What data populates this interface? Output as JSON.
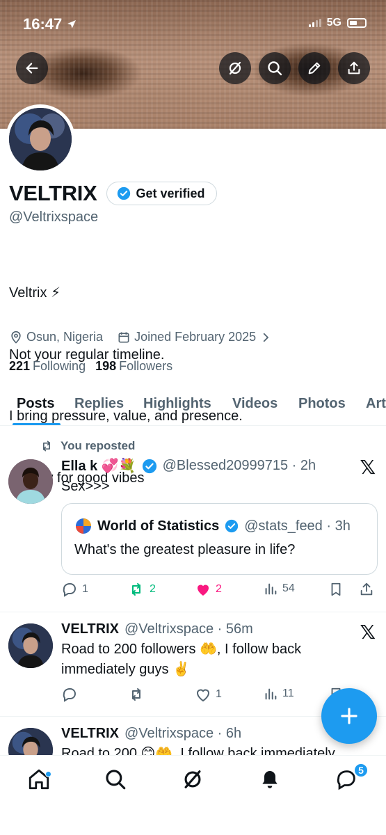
{
  "status_bar": {
    "time": "16:47",
    "network": "5G"
  },
  "profile": {
    "display_name": "VELTRIX",
    "verify_label": "Get verified",
    "handle": "@Veltrixspace",
    "bio_lines": [
      "Veltrix ⚡",
      "Not your regular timeline.",
      "I bring pressure, value, and presence.",
      " Follow for good vibes"
    ],
    "location": "Osun, Nigeria",
    "joined": "Joined February 2025",
    "following_count": "221",
    "following_label": "Following",
    "followers_count": "198",
    "followers_label": "Followers"
  },
  "tabs": [
    "Posts",
    "Replies",
    "Highlights",
    "Videos",
    "Photos",
    "Art"
  ],
  "posts": [
    {
      "repost_label": "You reposted",
      "name": "Ella k 💞💐",
      "handle_time": "@Blessed20999715 · 2h",
      "text": "Sex>>>",
      "quote": {
        "name": "World of Statistics",
        "handle_time": "@stats_feed · 3h",
        "text": "What's the greatest pleasure in life?"
      },
      "replies": "1",
      "reposts": "2",
      "likes": "2",
      "views": "54"
    },
    {
      "name": "VELTRIX",
      "handle_time": "@Veltrixspace · 56m",
      "text": "Road to 200 followers 🤲, I follow back immediately guys ✌️",
      "replies": "",
      "reposts": "",
      "likes": "1",
      "views": "11"
    },
    {
      "name": "VELTRIX",
      "handle_time": "@Veltrixspace · 6h",
      "text": "Road to 200 😊🤲, I follow back immediately"
    }
  ],
  "nav": {
    "messages_badge": "5"
  },
  "colors": {
    "accent": "#1d9bf0",
    "repost_green": "#00ba7c",
    "like_pink": "#f91880"
  }
}
